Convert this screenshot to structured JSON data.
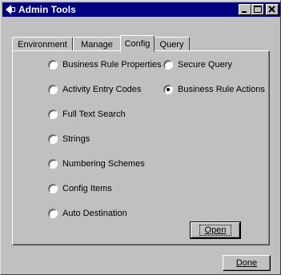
{
  "window": {
    "title": "Admin Tools"
  },
  "tabs": [
    {
      "label": "Environment",
      "active": false
    },
    {
      "label": "Manage",
      "active": false
    },
    {
      "label": "Config",
      "active": true
    },
    {
      "label": "Query",
      "active": false
    }
  ],
  "options_left": [
    {
      "label": "Business Rule Properties",
      "checked": false
    },
    {
      "label": "Activity Entry Codes",
      "checked": false
    },
    {
      "label": "Full Text Search",
      "checked": false
    },
    {
      "label": "Strings",
      "checked": false
    },
    {
      "label": "Numbering Schemes",
      "checked": false
    },
    {
      "label": "Config Items",
      "checked": false
    },
    {
      "label": "Auto Destination",
      "checked": false
    }
  ],
  "options_right": [
    {
      "label": "Secure Query",
      "checked": false
    },
    {
      "label": "Business Rule Actions",
      "checked": true
    }
  ],
  "buttons": {
    "open": "Open",
    "done": "Done"
  }
}
